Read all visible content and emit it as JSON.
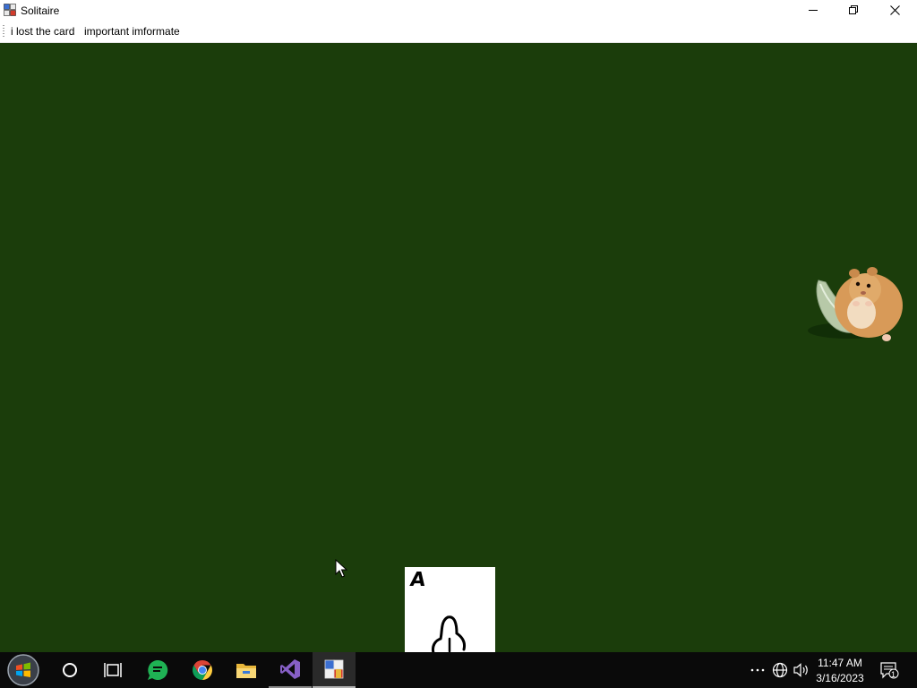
{
  "window": {
    "title": "Solitaire",
    "icon": "solitaire-app-icon",
    "controls": [
      "minimize-icon",
      "restore-icon",
      "close-icon"
    ]
  },
  "menu": {
    "items": [
      {
        "label": "i lost the card"
      },
      {
        "label": "important imformate"
      }
    ]
  },
  "board": {
    "background": "#1b3d0b",
    "card": {
      "rank": "A",
      "suit_icon": "hand-drawn-suit-icon"
    },
    "image": "hamster-on-leaf-image"
  },
  "taskbar": {
    "apps": [
      "start-icon",
      "cortana-icon",
      "task-view-icon",
      "chat-app-icon",
      "chrome-icon",
      "file-explorer-icon",
      "visual-studio-icon",
      "solitaire-app-icon"
    ],
    "tray_icons": [
      "overflow-icon",
      "network-icon",
      "volume-icon"
    ],
    "time": "11:47 AM",
    "date": "3/16/2023",
    "notification_count": "1"
  }
}
